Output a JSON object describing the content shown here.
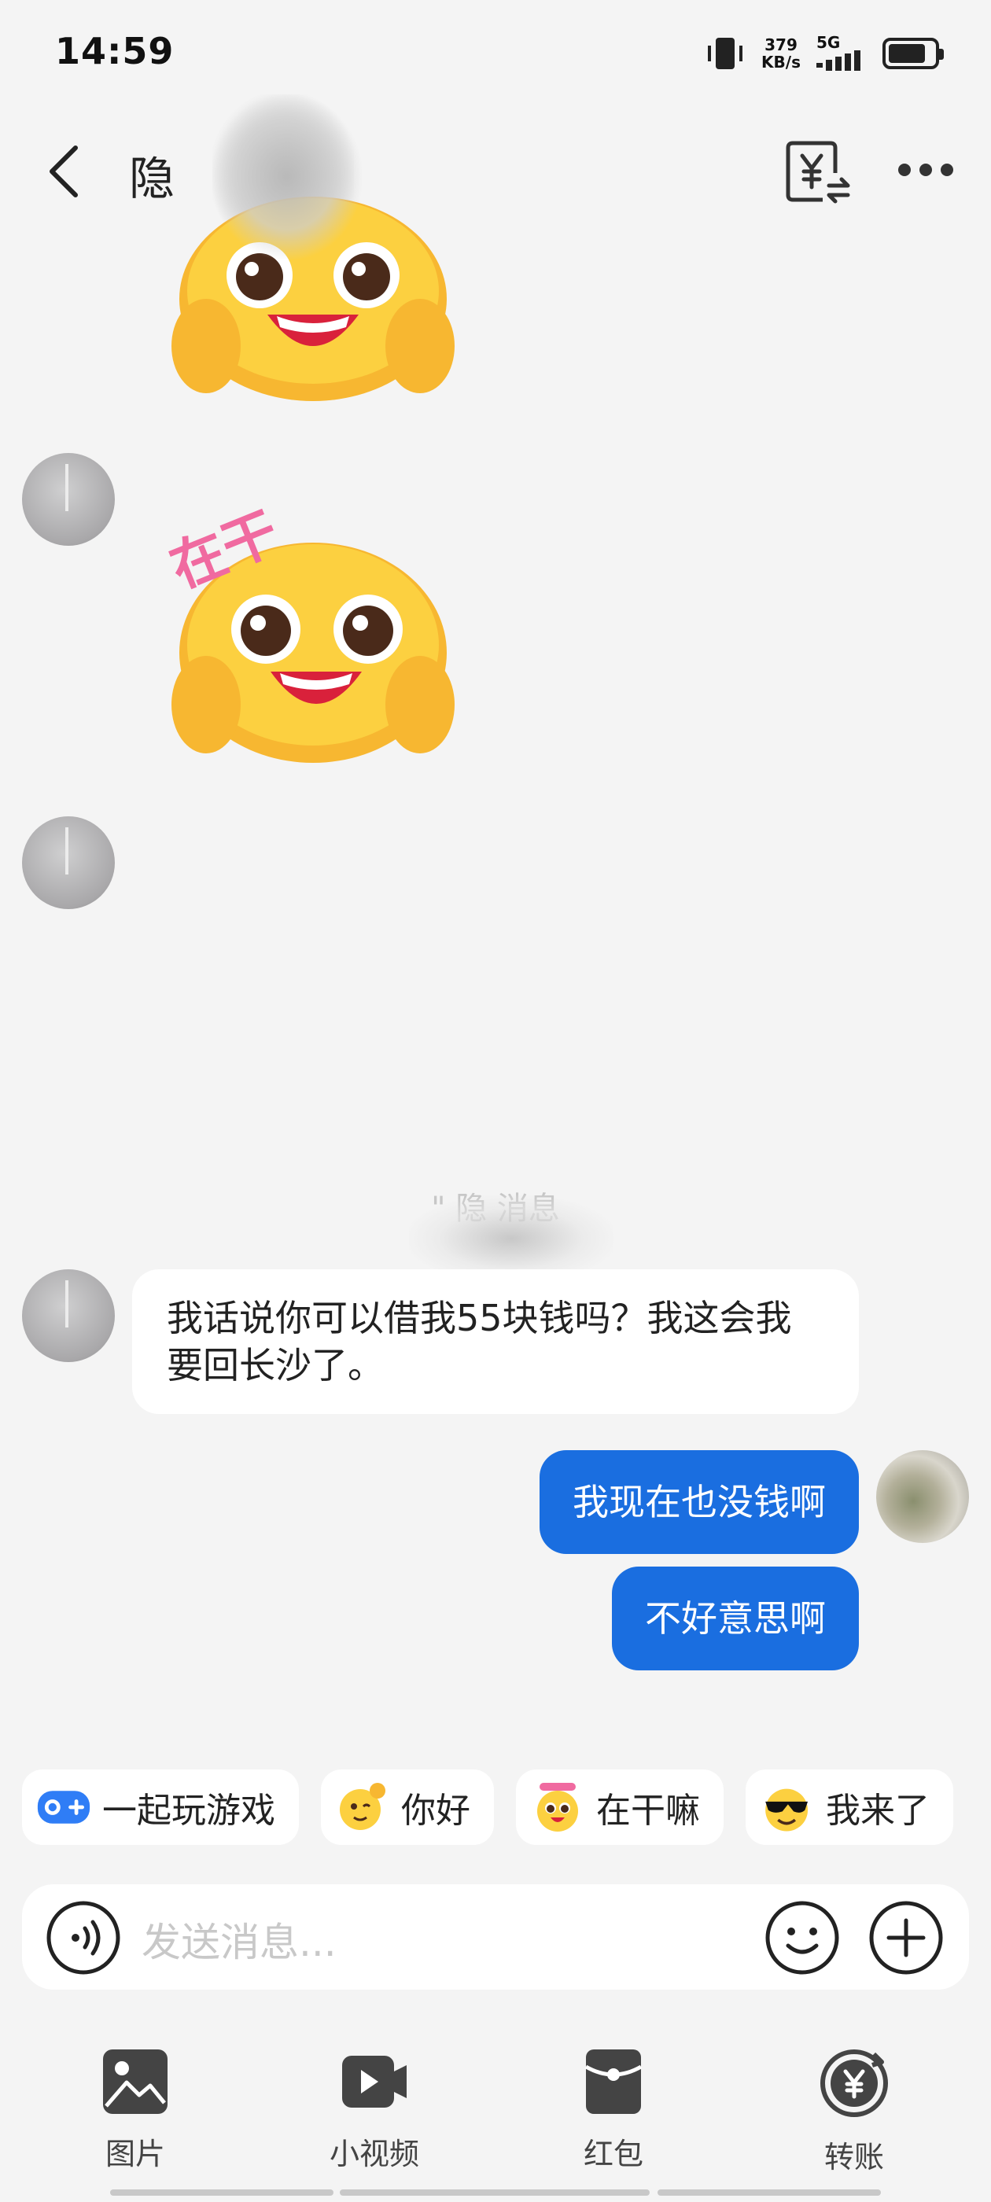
{
  "status_bar": {
    "time": "14:59",
    "speed_value": "379",
    "speed_unit": "KB/s",
    "network": "5G",
    "battery_level": 0.82
  },
  "header": {
    "title": "隐"
  },
  "messages": {
    "recall_notice": "\" 隐                           消息",
    "incoming_text": "我话说你可以借我55块钱吗？我这会我要回长沙了。",
    "outgoing_1": "我现在也没钱啊",
    "outgoing_2": "不好意思啊"
  },
  "sticker_text": "在干",
  "quick_replies": [
    {
      "label": "一起玩游戏",
      "icon": "gamepad-icon"
    },
    {
      "label": "你好",
      "icon": "hi-emoji-icon"
    },
    {
      "label": "在干嘛",
      "icon": "sticker-emoji-icon"
    },
    {
      "label": "我来了",
      "icon": "sunglasses-emoji-icon"
    }
  ],
  "input": {
    "placeholder": "发送消息..."
  },
  "toolbar": {
    "image": "图片",
    "video": "小视频",
    "red_packet": "红包",
    "transfer": "转账"
  },
  "colors": {
    "accent": "#1a6ee0",
    "background": "#f4f4f4",
    "bubble_in": "#ffffff"
  }
}
